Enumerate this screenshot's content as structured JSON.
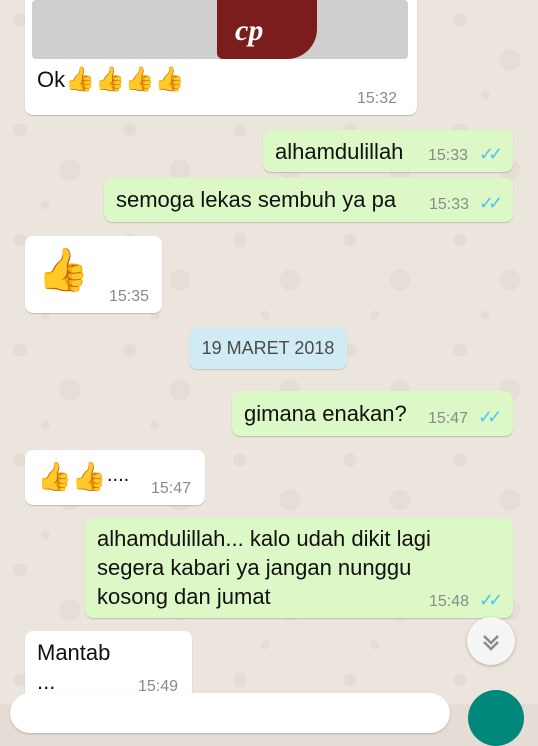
{
  "messages": [
    {
      "id": "m1",
      "dir": "in",
      "text": "Ok",
      "emojis": "👍👍👍👍",
      "time": "15:32",
      "photo_text": "cp"
    },
    {
      "id": "m2",
      "dir": "out",
      "text": "alhamdulillah",
      "time": "15:33"
    },
    {
      "id": "m3",
      "dir": "out",
      "text": "semoga lekas sembuh ya pa",
      "time": "15:33"
    },
    {
      "id": "m4",
      "dir": "in",
      "emojis": "👍",
      "time": "15:35"
    },
    {
      "id": "m5",
      "dir": "out",
      "text": "gimana enakan?",
      "time": "15:47"
    },
    {
      "id": "m6",
      "dir": "in",
      "emojis": "👍👍",
      "text": "....",
      "time": "15:47"
    },
    {
      "id": "m7",
      "dir": "out",
      "lines": [
        "alhamdulillah... kalo udah dikit lagi",
        "segera kabari ya jangan nunggu",
        "kosong dan jumat"
      ],
      "time": "15:48"
    },
    {
      "id": "m8",
      "dir": "in",
      "text": "Mantab",
      "text2": "...",
      "time": "15:49"
    }
  ],
  "date_separator": "19 MARET 2018",
  "colors": {
    "incoming": "#ffffff",
    "outgoing": "#dcf8c6",
    "read_tick": "#4fc3f7",
    "date_chip": "#d1ebf4",
    "send": "#00897b"
  },
  "icons": {
    "read": "double-check-icon",
    "scroll": "chevron-down-icon"
  }
}
